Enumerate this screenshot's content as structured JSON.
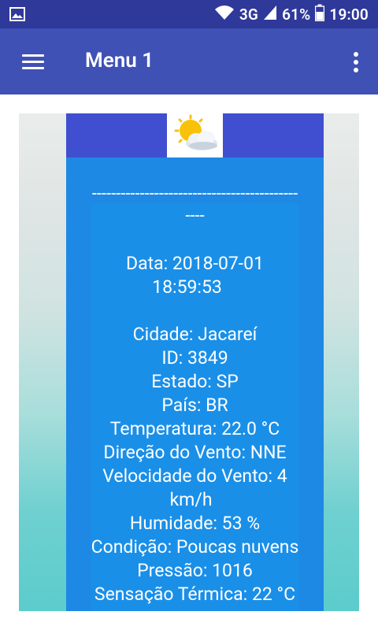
{
  "status_bar": {
    "network": "3G",
    "battery": "61%",
    "time": "19:00",
    "icons": [
      "image-icon",
      "wifi-icon",
      "signal-icon",
      "battery-icon"
    ]
  },
  "app_bar": {
    "title": "Menu 1",
    "colors": {
      "primary": "#3f51b5",
      "status": "#2f399a"
    }
  },
  "weather": {
    "icon": "partly-cloudy-icon",
    "separator": "-------------------------------------------",
    "separator_tail": "----",
    "date_line1": "Data: 2018-07-01",
    "date_line2": "18:59:53",
    "city": "Cidade: Jacareí",
    "id": "ID: 3849",
    "state": "Estado: SP",
    "country": "País: BR",
    "temperature": "Temperatura: 22.0 °C",
    "wind_direction": "Direção do Vento: NNE",
    "wind_speed_line1": "Velocidade do Vento: 4",
    "wind_speed_line2": "km/h",
    "humidity": "Humidade: 53 %",
    "condition": "Condição: Poucas nuvens",
    "pressure": "Pressão: 1016",
    "feels_like": "Sensação Térmica: 22 °C"
  }
}
